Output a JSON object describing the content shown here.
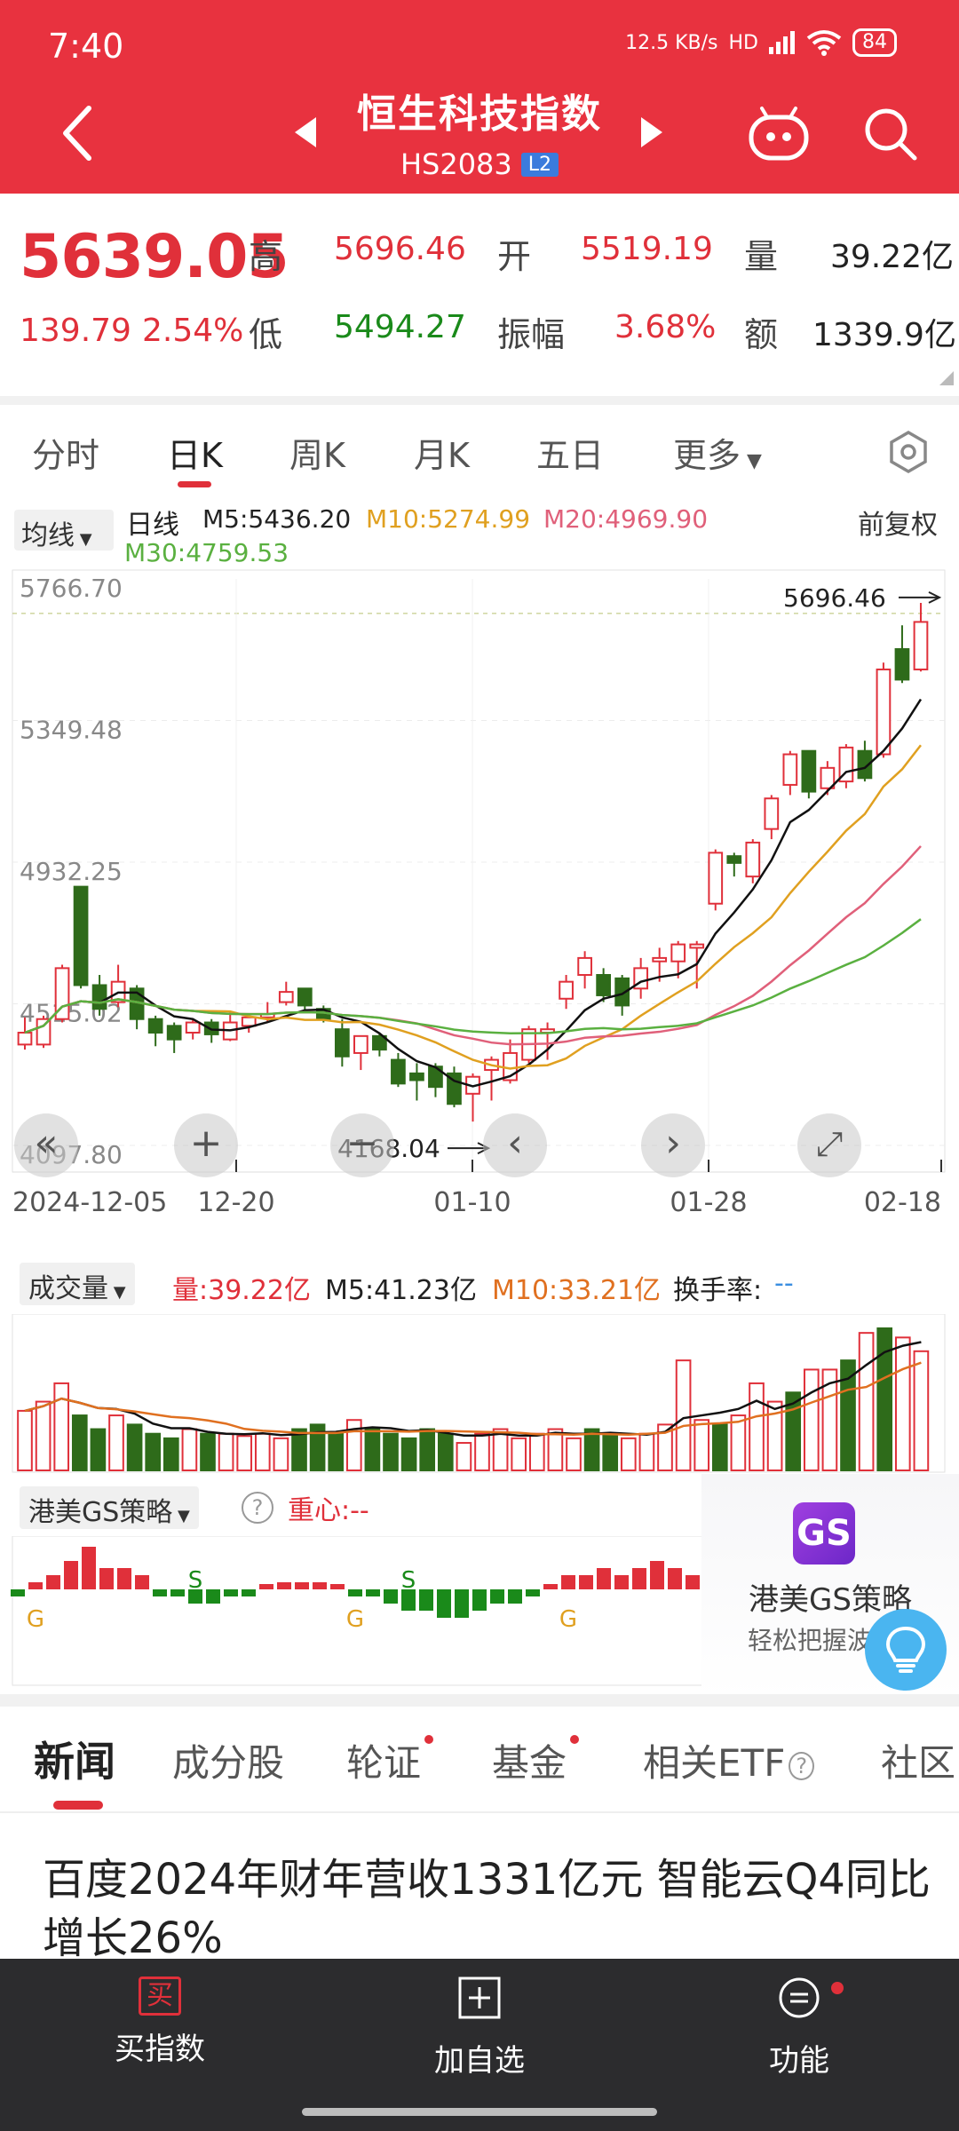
{
  "status": {
    "time": "7:40",
    "net_speed": "12.5 KB/s",
    "net": "HD",
    "battery": "84"
  },
  "header": {
    "title": "恒生科技指数",
    "code": "HS2083",
    "level": "L2"
  },
  "quote": {
    "price": "5639.05",
    "change": "139.79",
    "change_pct": "2.54%",
    "high_label": "高",
    "high": "5696.46",
    "open_label": "开",
    "open": "5519.19",
    "vol_label": "量",
    "vol": "39.22亿",
    "low_label": "低",
    "low": "5494.27",
    "amp_label": "振幅",
    "amp": "3.68%",
    "amt_label": "额",
    "amt": "1339.9亿"
  },
  "ktabs": [
    "分时",
    "日K",
    "周K",
    "月K",
    "五日",
    "更多"
  ],
  "ma": {
    "select": "均线",
    "line": "日线",
    "m5": "M5:5436.20",
    "m10": "M10:5274.99",
    "m20": "M20:4969.90",
    "m30": "M30:4759.53",
    "restore": "前复权"
  },
  "chart_data": [
    {
      "type": "candlestick",
      "title": "日线",
      "y_ticks": [
        "5766.70",
        "5349.48",
        "4932.25",
        "4515.02",
        "4097.80"
      ],
      "x_ticks": [
        "2024-12-05",
        "12-20",
        "01-10",
        "01-28",
        "02-18"
      ],
      "ylim": [
        4097.8,
        5766.7
      ],
      "max_label": "5696.46",
      "min_label": "4168.04",
      "candles": [
        {
          "o": 4395,
          "c": 4430,
          "h": 4475,
          "l": 4380
        },
        {
          "o": 4395,
          "c": 4470,
          "h": 4480,
          "l": 4385
        },
        {
          "o": 4470,
          "c": 4620,
          "h": 4630,
          "l": 4460
        },
        {
          "o": 4860,
          "c": 4570,
          "h": 4860,
          "l": 4560
        },
        {
          "o": 4570,
          "c": 4500,
          "h": 4600,
          "l": 4480
        },
        {
          "o": 4520,
          "c": 4580,
          "h": 4630,
          "l": 4505
        },
        {
          "o": 4560,
          "c": 4470,
          "h": 4570,
          "l": 4440
        },
        {
          "o": 4470,
          "c": 4430,
          "h": 4480,
          "l": 4390
        },
        {
          "o": 4450,
          "c": 4410,
          "h": 4460,
          "l": 4370
        },
        {
          "o": 4430,
          "c": 4460,
          "h": 4470,
          "l": 4410
        },
        {
          "o": 4460,
          "c": 4425,
          "h": 4470,
          "l": 4400
        },
        {
          "o": 4410,
          "c": 4460,
          "h": 4490,
          "l": 4405
        },
        {
          "o": 4450,
          "c": 4475,
          "h": 4480,
          "l": 4430
        },
        {
          "o": 4475,
          "c": 4485,
          "h": 4520,
          "l": 4460
        },
        {
          "o": 4520,
          "c": 4550,
          "h": 4580,
          "l": 4510
        },
        {
          "o": 4560,
          "c": 4510,
          "h": 4560,
          "l": 4490
        },
        {
          "o": 4500,
          "c": 4470,
          "h": 4510,
          "l": 4460
        },
        {
          "o": 4440,
          "c": 4360,
          "h": 4470,
          "l": 4330
        },
        {
          "o": 4370,
          "c": 4420,
          "h": 4420,
          "l": 4320
        },
        {
          "o": 4420,
          "c": 4380,
          "h": 4430,
          "l": 4360
        },
        {
          "o": 4350,
          "c": 4280,
          "h": 4370,
          "l": 4270
        },
        {
          "o": 4310,
          "c": 4290,
          "h": 4340,
          "l": 4230
        },
        {
          "o": 4330,
          "c": 4270,
          "h": 4340,
          "l": 4240
        },
        {
          "o": 4310,
          "c": 4220,
          "h": 4330,
          "l": 4210
        },
        {
          "o": 4250,
          "c": 4300,
          "h": 4310,
          "l": 4168
        },
        {
          "o": 4320,
          "c": 4350,
          "h": 4360,
          "l": 4230
        },
        {
          "o": 4290,
          "c": 4370,
          "h": 4410,
          "l": 4280
        },
        {
          "o": 4350,
          "c": 4440,
          "h": 4450,
          "l": 4340
        },
        {
          "o": 4430,
          "c": 4440,
          "h": 4460,
          "l": 4350
        },
        {
          "o": 4530,
          "c": 4580,
          "h": 4600,
          "l": 4500
        },
        {
          "o": 4600,
          "c": 4650,
          "h": 4670,
          "l": 4560
        },
        {
          "o": 4600,
          "c": 4540,
          "h": 4620,
          "l": 4520
        },
        {
          "o": 4590,
          "c": 4510,
          "h": 4600,
          "l": 4480
        },
        {
          "o": 4560,
          "c": 4620,
          "h": 4650,
          "l": 4530
        },
        {
          "o": 4640,
          "c": 4650,
          "h": 4680,
          "l": 4580
        },
        {
          "o": 4640,
          "c": 4690,
          "h": 4700,
          "l": 4590
        },
        {
          "o": 4680,
          "c": 4690,
          "h": 4700,
          "l": 4560
        },
        {
          "o": 4810,
          "c": 4960,
          "h": 4970,
          "l": 4790
        },
        {
          "o": 4950,
          "c": 4930,
          "h": 4960,
          "l": 4890
        },
        {
          "o": 4890,
          "c": 4990,
          "h": 5000,
          "l": 4870
        },
        {
          "o": 5030,
          "c": 5120,
          "h": 5130,
          "l": 5000
        },
        {
          "o": 5160,
          "c": 5250,
          "h": 5260,
          "l": 5130
        },
        {
          "o": 5260,
          "c": 5140,
          "h": 5260,
          "l": 5120
        },
        {
          "o": 5150,
          "c": 5210,
          "h": 5230,
          "l": 5130
        },
        {
          "o": 5170,
          "c": 5270,
          "h": 5280,
          "l": 5150
        },
        {
          "o": 5260,
          "c": 5180,
          "h": 5290,
          "l": 5170
        },
        {
          "o": 5250,
          "c": 5500,
          "h": 5520,
          "l": 5240
        },
        {
          "o": 5560,
          "c": 5470,
          "h": 5630,
          "l": 5460
        },
        {
          "o": 5500,
          "c": 5640,
          "h": 5696,
          "l": 5494
        }
      ]
    },
    {
      "type": "bar",
      "title": "成交量",
      "series_values": [
        26,
        30,
        38,
        24,
        18,
        24,
        20,
        16,
        14,
        18,
        16,
        16,
        15,
        16,
        14,
        18,
        20,
        16,
        22,
        18,
        16,
        14,
        18,
        16,
        12,
        16,
        18,
        14,
        16,
        18,
        14,
        18,
        16,
        14,
        16,
        20,
        48,
        22,
        20,
        24,
        38,
        30,
        34,
        44,
        44,
        48,
        60,
        62,
        58,
        52
      ],
      "labels": {
        "select": "成交量",
        "vol": "量:39.22亿",
        "m5": "M5:41.23亿",
        "m10": "M10:33.21亿",
        "turnover": "换手率:",
        "turnover_val": "--"
      }
    },
    {
      "type": "bar",
      "title": "港美GS策略",
      "series_values": [
        -1,
        1,
        2,
        4,
        6,
        3,
        3,
        2,
        -1,
        -1,
        -2,
        -2,
        -1,
        -1,
        0,
        1,
        1,
        1,
        0,
        -1,
        -1,
        -2,
        -3,
        -3,
        -4,
        -4,
        -3,
        -2,
        -2,
        -1,
        0,
        2,
        2,
        3,
        2,
        3,
        4,
        3,
        2,
        1
      ],
      "markers": [
        {
          "i": 1,
          "t": "G"
        },
        {
          "i": 10,
          "t": "S"
        },
        {
          "i": 19,
          "t": "G"
        },
        {
          "i": 22,
          "t": "S"
        },
        {
          "i": 31,
          "t": "G"
        }
      ],
      "labels": {
        "select": "港美GS策略",
        "help": "?",
        "center": "重心:--"
      }
    }
  ],
  "chart_controls": {
    "zoom_out": "«",
    "plus": "+",
    "minus": "−",
    "prev": "‹",
    "next": "›",
    "fullscreen": "⤢"
  },
  "gs_card": {
    "icon": "GS",
    "title": "港美GS策略",
    "subtitle": "轻松把握波段"
  },
  "news_tabs": [
    "新闻",
    "成分股",
    "轮证",
    "基金",
    "相关ETF",
    "社区"
  ],
  "news": {
    "headline": "百度2024年财年营收1331亿元 智能云Q4同比增长26%"
  },
  "bottom_bar": {
    "buy": "买指数",
    "buy_icon": "买",
    "add": "加自选",
    "functions": "功能"
  }
}
